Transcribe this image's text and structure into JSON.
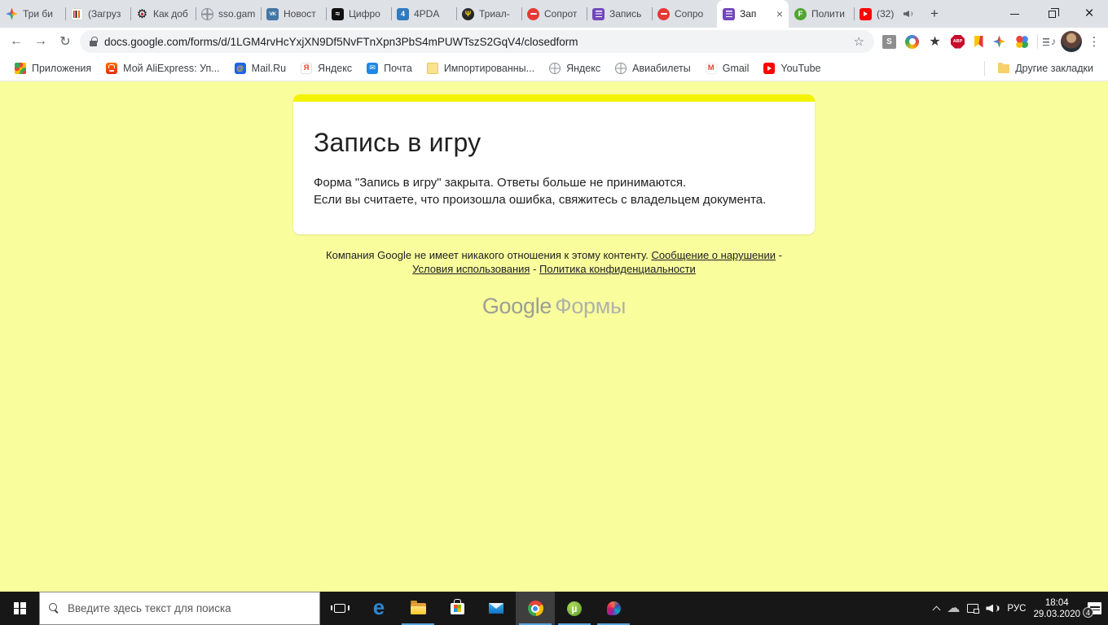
{
  "browser": {
    "tabs": [
      {
        "label": "Три би",
        "icon": "sparkle-icon"
      },
      {
        "label": "(Загруз",
        "icon": "bars-icon"
      },
      {
        "label": "Как доб",
        "icon": "gear-icon"
      },
      {
        "label": "sso.gam",
        "icon": "globe-icon"
      },
      {
        "label": "Новост",
        "icon": "vk-icon"
      },
      {
        "label": "Цифро",
        "icon": "swirl-icon"
      },
      {
        "label": "4PDA",
        "icon": "fourpda-icon"
      },
      {
        "label": "Триал-",
        "icon": "trident-icon"
      },
      {
        "label": "Сопрот",
        "icon": "blocked-icon"
      },
      {
        "label": "Запись",
        "icon": "forms-icon"
      },
      {
        "label": "Сопро",
        "icon": "blocked-icon"
      },
      {
        "label": "Зап",
        "icon": "forms-icon",
        "active": true,
        "closable": true
      },
      {
        "label": "Полити",
        "icon": "fandom-icon"
      },
      {
        "label": "(32)",
        "icon": "youtube-icon",
        "audio": true
      }
    ],
    "icons": {
      "new_tab": "+",
      "close": "×",
      "back": "←",
      "forward": "→",
      "reload": "↻",
      "bookmark_star": "☆",
      "overflow_menu": "⋮",
      "media_note": "♪",
      "cloud": "☁"
    },
    "omnibox": {
      "url": "docs.google.com/forms/d/1LGM4rvHcYxjXN9Df5NvFTnXpn3PbS4mPUWTszS2GqV4/closedform"
    },
    "extensions": [
      {
        "icon": "s-extension-icon"
      },
      {
        "icon": "shopping-extension-icon"
      },
      {
        "icon": "star-extension-icon"
      },
      {
        "icon": "abp-extension-icon"
      },
      {
        "icon": "flag-extension-icon"
      },
      {
        "icon": "sparkle-extension-icon"
      },
      {
        "icon": "dots-extension-icon"
      }
    ],
    "bookmarks": [
      {
        "label": "Приложения",
        "icon": "apps-grid-icon"
      },
      {
        "label": "Мой AliExpress: Уп...",
        "icon": "aliexpress-icon"
      },
      {
        "label": "Mail.Ru",
        "icon": "mailru-icon"
      },
      {
        "label": "Яндекс",
        "icon": "yandex-icon"
      },
      {
        "label": "Почта",
        "icon": "mail-badge-icon"
      },
      {
        "label": "Импортированны...",
        "icon": "doc-icon"
      },
      {
        "label": "Яндекс",
        "icon": "globe-icon"
      },
      {
        "label": "Авиабилеты",
        "icon": "globe-icon"
      },
      {
        "label": "Gmail",
        "icon": "gmail-icon"
      },
      {
        "label": "YouTube",
        "icon": "youtube-icon"
      }
    ],
    "other_bookmarks": {
      "label": "Другие закладки",
      "icon": "folder-icon"
    }
  },
  "page": {
    "colors": {
      "background": "#f9fd9c",
      "theme_bar": "#f3f300",
      "card": "#ffffff"
    },
    "card": {
      "title": "Запись в игру",
      "line1": "Форма \"Запись в игру\" закрыта. Ответы больше не принимаются.",
      "line2": "Если вы считаете, что произошла ошибка, свяжитесь с владельцем документа."
    },
    "disclaimer": {
      "text": "Компания Google не имеет никакого отношения к этому контенту.",
      "links": [
        "Сообщение о нарушении",
        "Условия использования",
        "Политика конфиденциальности"
      ],
      "separator": " - "
    },
    "logo": {
      "google": "Google",
      "forms": "Формы"
    }
  },
  "taskbar": {
    "search_placeholder": "Введите здесь текст для поиска",
    "apps": [
      {
        "name": "task-view-button",
        "icon": "task-view-icon"
      },
      {
        "name": "edge-button",
        "icon": "edge-icon",
        "glyph": "e"
      },
      {
        "name": "file-explorer-button",
        "icon": "folder-win-icon",
        "running": true
      },
      {
        "name": "store-button",
        "icon": "store-icon"
      },
      {
        "name": "mail-button",
        "icon": "mail-win-icon"
      },
      {
        "name": "chrome-button",
        "icon": "chrome-icon",
        "running": true,
        "active": true
      },
      {
        "name": "utorrent-button",
        "icon": "utorrent-icon",
        "running": true
      },
      {
        "name": "paint-button",
        "icon": "paint-icon",
        "running": true
      }
    ],
    "tray": {
      "language": "РУС",
      "time": "18:04",
      "date": "29.03.2020",
      "notification_count": "4"
    }
  }
}
